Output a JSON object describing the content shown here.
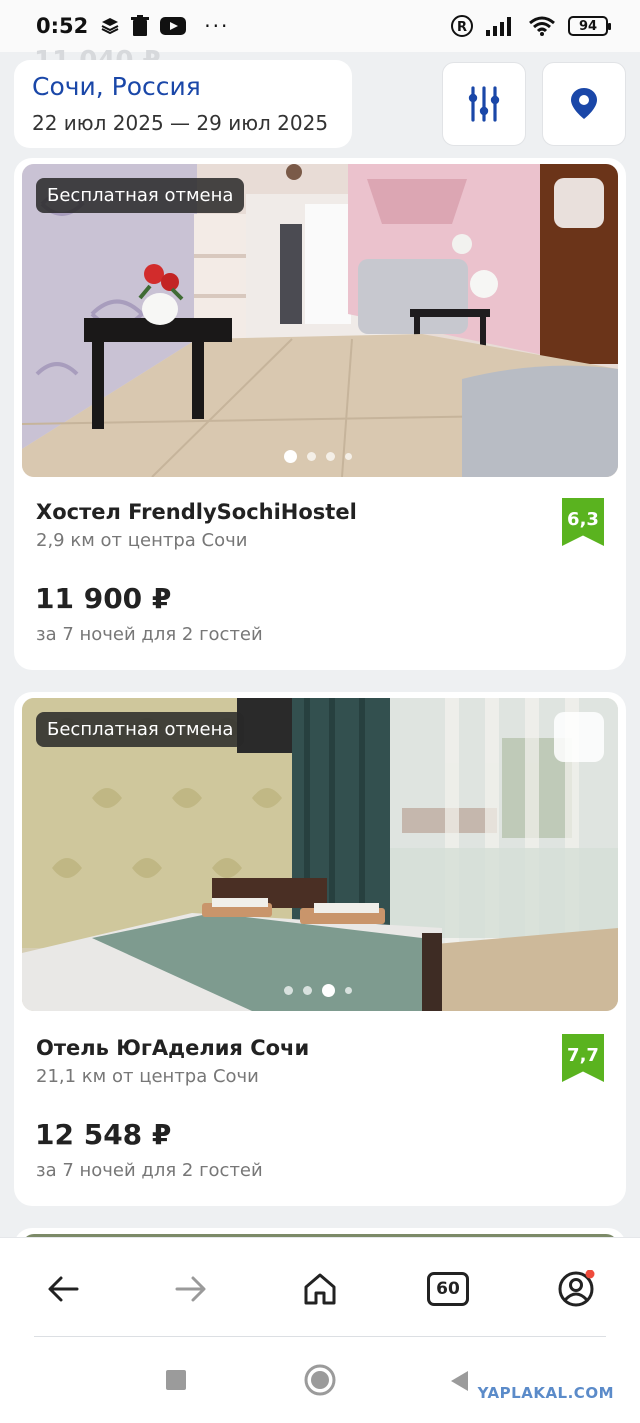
{
  "status_bar": {
    "time": "0:52",
    "battery": "94"
  },
  "ghost_price": "11 040 ₽",
  "search": {
    "city": "Сочи, Россия",
    "dates": "22 июл 2025 — 29 июл 2025"
  },
  "listings": [
    {
      "badge": "Бесплатная отмена",
      "title": "Хостел FrendlySochiHostel",
      "distance": "2,9 км от центра Сочи",
      "price": "11 900 ₽",
      "nights": "за 7 ночей для 2 гостей",
      "rating": "6,3",
      "active_photo_index": 0
    },
    {
      "badge": "Бесплатная отмена",
      "title": "Отель ЮгАделия Сочи",
      "distance": "21,1 км от центра Сочи",
      "price": "12 548 ₽",
      "nights": "за 7 ночей для 2 гостей",
      "rating": "7,7",
      "active_photo_index": 2
    }
  ],
  "bottom_nav": {
    "tabs_count": "60"
  },
  "watermark": "YAPLAKAL.COM",
  "colors": {
    "accent": "#1a47a8",
    "rating_green": "#5ab31f",
    "notification_dot": "#ef4b3c"
  }
}
